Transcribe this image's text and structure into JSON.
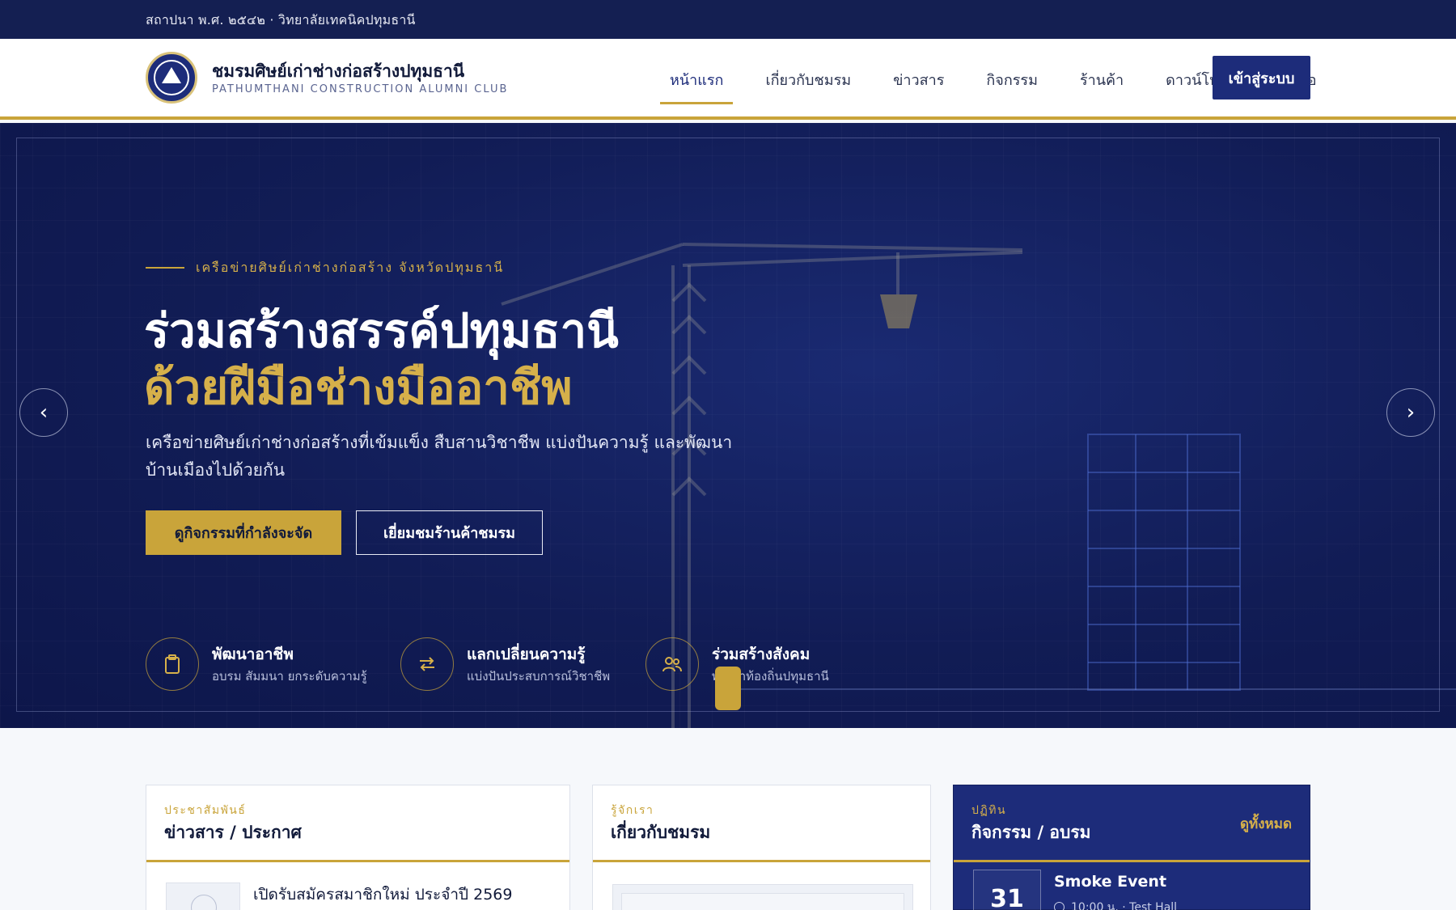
{
  "topbar": {
    "text": "สถาปนา พ.ศ. ๒๕๔๒ · วิทยาลัยเทคนิคปทุมธานี"
  },
  "brand": {
    "name_th": "ชมรมศิษย์เก่าช่างก่อสร้างปทุมธานี",
    "name_en": "PATHUMTHANI CONSTRUCTION ALUMNI CLUB",
    "logo_icon": "club-emblem"
  },
  "nav": {
    "items": [
      "หน้าแรก",
      "เกี่ยวกับชมรม",
      "ข่าวสาร",
      "กิจกรรม",
      "ร้านค้า",
      "ดาวน์โหลด",
      "ติดต่อ"
    ],
    "active": "หน้าแรก",
    "login": "เข้าสู่ระบบ"
  },
  "hero": {
    "eyebrow": "เครือข่ายศิษย์เก่าช่างก่อสร้าง จังหวัดปทุมธานี",
    "title_line1": "ร่วมสร้างสรรค์ปทุมธานี",
    "title_line2": "ด้วยฝีมือช่างมืออาชีพ",
    "lead": "เครือข่ายศิษย์เก่าช่างก่อสร้างที่เข้มแข็ง สืบสานวิชาชีพ แบ่งปันความรู้ และพัฒนาบ้านเมืองไปด้วยกัน",
    "primary_button": "ดูกิจกรรมที่กำลังจะจัด",
    "secondary_button": "เยี่ยมชมร้านค้าชมรม",
    "prev": "‹",
    "next": "›",
    "features": [
      {
        "title": "พัฒนาอาชีพ",
        "subtitle": "อบรม สัมมนา ยกระดับความรู้",
        "icon": "clipboard-icon"
      },
      {
        "title": "แลกเปลี่ยนความรู้",
        "subtitle": "แบ่งปันประสบการณ์วิชาชีพ",
        "icon": "exchange-icon"
      },
      {
        "title": "ร่วมสร้างสังคม",
        "subtitle": "พัฒนาท้องถิ่นปทุมธานี",
        "icon": "people-icon"
      }
    ]
  },
  "cards": {
    "news": {
      "kicker": "ประชาสัมพันธ์",
      "title": "ข่าวสาร / ประกาศ",
      "first_item": "เปิดรับสมัครสมาชิกใหม่ ประจำปี 2569"
    },
    "about": {
      "kicker": "รู้จักเรา",
      "title": "เกี่ยวกับชมรม"
    },
    "events": {
      "kicker": "ปฏิทิน",
      "title": "กิจกรรม / อบรม",
      "see_all": "ดูทั้งหมด",
      "first": {
        "day": "31",
        "title": "Smoke Event",
        "meta": "10:00 น. · Test Hall"
      }
    }
  },
  "colors": {
    "navy": "#1d2c7a",
    "gold": "#c9a43a",
    "dark": "#141f52"
  }
}
